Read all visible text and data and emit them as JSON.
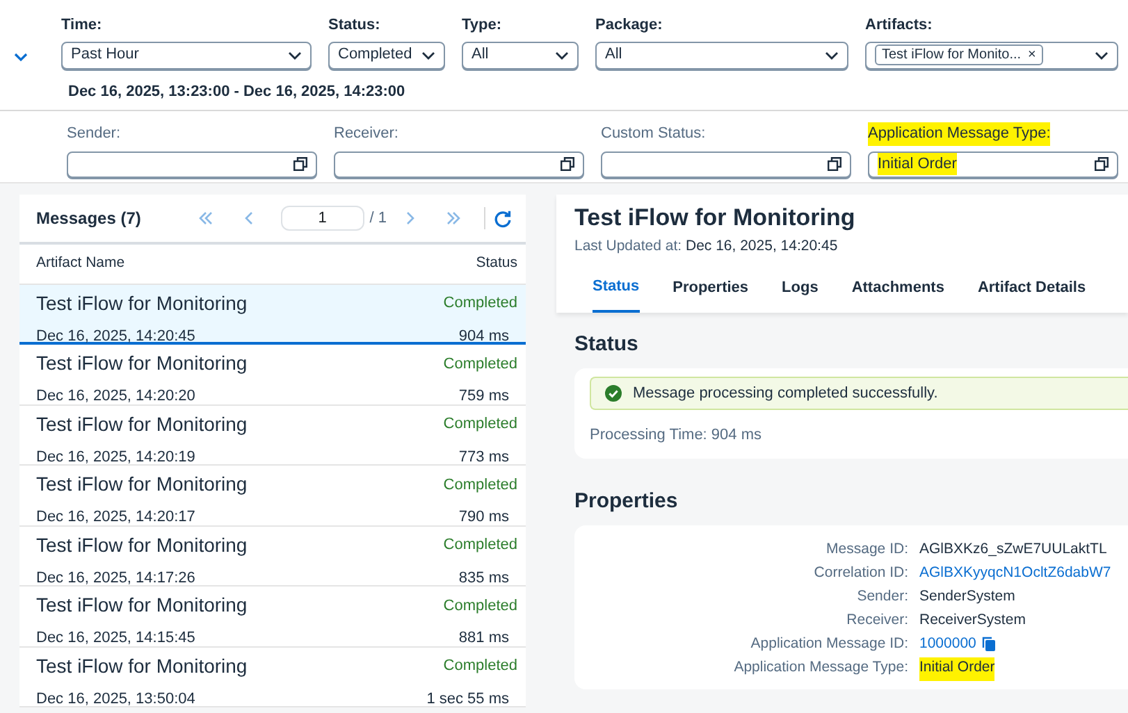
{
  "filters": [
    {
      "label": "Time:",
      "value": "Past Hour",
      "kind": "select"
    },
    {
      "label": "Status:",
      "value": "Completed",
      "kind": "select"
    },
    {
      "label": "Type:",
      "value": "All",
      "kind": "select"
    },
    {
      "label": "Package:",
      "value": "All",
      "kind": "select"
    },
    {
      "label": "Artifacts:",
      "token": "Test iFlow for Monito...",
      "token_close": "×",
      "kind": "tokens"
    }
  ],
  "time_range": "Dec 16, 2025, 13:23:00 - Dec 16, 2025, 14:23:00",
  "extra_filters": [
    {
      "label": "Sender:",
      "highlighted": false
    },
    {
      "label": "Receiver:",
      "highlighted": false
    },
    {
      "label": "Custom Status:",
      "highlighted": false
    },
    {
      "label": "Application Message Type:",
      "value": "Initial Order",
      "highlighted": true
    }
  ],
  "messages": {
    "title": "Messages (7)",
    "page": "1",
    "page_total": "/ 1",
    "columns": [
      "Artifact Name",
      "Status"
    ],
    "rows": [
      {
        "name": "Test iFlow for Monitoring",
        "status": "Completed",
        "date": "Dec 16, 2025, 14:20:45",
        "duration": "904 ms",
        "selected": true
      },
      {
        "name": "Test iFlow for Monitoring",
        "status": "Completed",
        "date": "Dec 16, 2025, 14:20:20",
        "duration": "759 ms",
        "selected": false
      },
      {
        "name": "Test iFlow for Monitoring",
        "status": "Completed",
        "date": "Dec 16, 2025, 14:20:19",
        "duration": "773 ms",
        "selected": false
      },
      {
        "name": "Test iFlow for Monitoring",
        "status": "Completed",
        "date": "Dec 16, 2025, 14:20:17",
        "duration": "790 ms",
        "selected": false
      },
      {
        "name": "Test iFlow for Monitoring",
        "status": "Completed",
        "date": "Dec 16, 2025, 14:17:26",
        "duration": "835 ms",
        "selected": false
      },
      {
        "name": "Test iFlow for Monitoring",
        "status": "Completed",
        "date": "Dec 16, 2025, 14:15:45",
        "duration": "881 ms",
        "selected": false
      },
      {
        "name": "Test iFlow for Monitoring",
        "status": "Completed",
        "date": "Dec 16, 2025, 13:50:04",
        "duration": "1 sec 55 ms",
        "selected": false
      }
    ]
  },
  "detail": {
    "title": "Test iFlow for Monitoring",
    "updated_label": "Last Updated at:",
    "updated_value": "Dec 16, 2025, 14:20:45",
    "tabs": [
      {
        "label": "Status",
        "selected": true
      },
      {
        "label": "Properties",
        "selected": false
      },
      {
        "label": "Logs",
        "selected": false
      },
      {
        "label": "Attachments",
        "selected": false
      },
      {
        "label": "Artifact Details",
        "selected": false
      }
    ],
    "status_heading": "Status",
    "status_message": "Message processing completed successfully.",
    "processing_time": "Processing Time: 904 ms",
    "properties_heading": "Properties",
    "properties": [
      {
        "label": "Message ID:",
        "value": "AGlBXKz6_sZwE7UULaktTL",
        "kind": "text",
        "highlighted": false
      },
      {
        "label": "Correlation ID:",
        "value": "AGlBXKyyqcN1OcltZ6dabW7",
        "kind": "link",
        "highlighted": false
      },
      {
        "label": "Sender:",
        "value": "SenderSystem",
        "kind": "text",
        "highlighted": false
      },
      {
        "label": "Receiver:",
        "value": "ReceiverSystem",
        "kind": "text",
        "highlighted": false
      },
      {
        "label": "Application Message ID:",
        "value": "1000000",
        "kind": "copy-link",
        "highlighted": false
      },
      {
        "label": "Application Message Type:",
        "value": "Initial Order",
        "kind": "text",
        "highlighted": true
      }
    ]
  }
}
